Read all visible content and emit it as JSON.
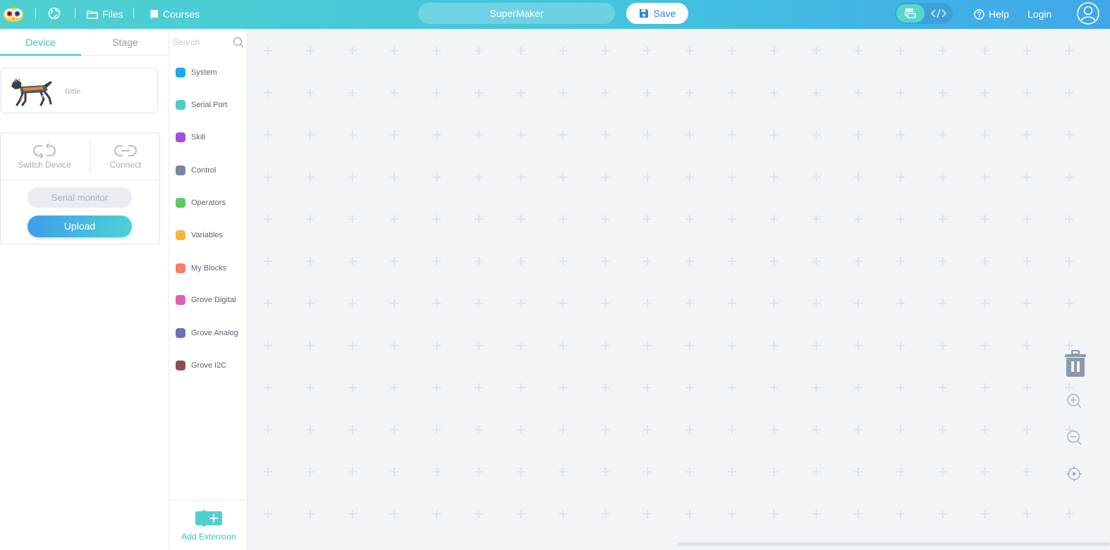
{
  "topbar": {
    "files_label": "Files",
    "courses_label": "Courses",
    "project_name": "SuperMaker",
    "save_label": "Save",
    "help_label": "Help",
    "login_label": "Login"
  },
  "left_panel": {
    "tabs": [
      {
        "label": "Device",
        "active": true
      },
      {
        "label": "Stage",
        "active": false
      }
    ],
    "device": {
      "name": "Bittle"
    },
    "actions": {
      "switch_device": "Switch Device",
      "connect": "Connect",
      "serial_monitor": "Serial monitor",
      "upload": "Upload"
    }
  },
  "categories": {
    "search_placeholder": "Search",
    "items": [
      {
        "label": "System",
        "color": "#1aa8f0"
      },
      {
        "label": "Serial Port",
        "color": "#4ecdc4"
      },
      {
        "label": "Skill",
        "color": "#a24fe0"
      },
      {
        "label": "Control",
        "color": "#7a86a0"
      },
      {
        "label": "Operators",
        "color": "#5ccc62"
      },
      {
        "label": "Variables",
        "color": "#ffb233"
      },
      {
        "label": "My Blocks",
        "color": "#ff7b6b"
      },
      {
        "label": "Grove Digital",
        "color": "#e060b0"
      },
      {
        "label": "Grove Analog",
        "color": "#6a72b8"
      },
      {
        "label": "Grove I2C",
        "color": "#8a5050"
      }
    ],
    "add_extension": "Add Extension"
  },
  "colors": {
    "accent": "#34c6c6",
    "topbar_start": "#4fd0cf",
    "topbar_end": "#3fa7ea",
    "workspace_bg": "#f2f5f8"
  }
}
